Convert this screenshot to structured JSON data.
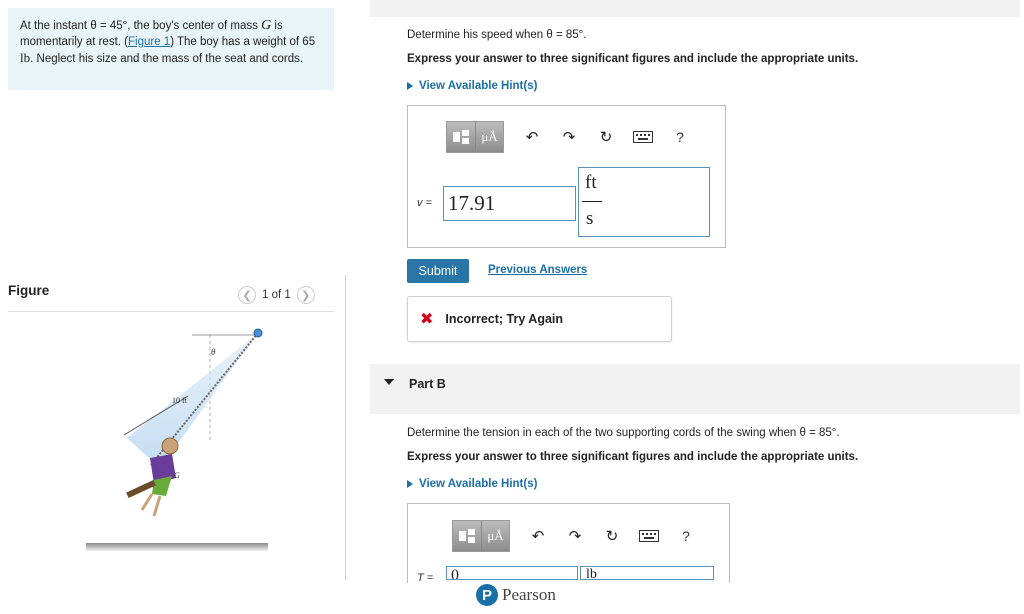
{
  "problem": {
    "text_1": "At the instant θ = 45°, the boy's center of mass ",
    "G": "G",
    "text_2": " is momentarily at rest. (",
    "figure_link": "Figure 1",
    "text_3": ") The boy has a weight of 65 ",
    "lb": "lb",
    "text_4": ". Neglect his size and the mass of the seat and cords."
  },
  "figure": {
    "heading": "Figure",
    "pager": "1 of 1",
    "prev_icon": "chevron-left-icon",
    "next_icon": "chevron-right-icon",
    "label_theta": "θ",
    "label_length": "10 ft",
    "label_G": "G"
  },
  "partA": {
    "question": "Determine his speed when θ = 85°.",
    "instruction": "Express your answer to three significant figures and include the appropriate units.",
    "hint_label": "View Available Hint(s)",
    "var_label": "v =",
    "value": "17.91",
    "unit_num": "ft",
    "unit_den": "s",
    "submit_label": "Submit",
    "previous_answers": "Previous Answers",
    "feedback": "Incorrect; Try Again"
  },
  "toolbar": {
    "mu_label": "μÅ",
    "undo_icon": "undo-icon",
    "redo_icon": "redo-icon",
    "reset_icon": "reset-icon",
    "keyboard_icon": "keyboard-icon",
    "help_label": "?"
  },
  "partB": {
    "title": "Part B",
    "question": "Determine the tension in each of the two supporting cords of the swing when θ = 85°.",
    "instruction": "Express your answer to three significant figures and include the appropriate units.",
    "hint_label": "View Available Hint(s)",
    "var_label": "T =",
    "value": "0",
    "unit": "lb"
  },
  "footer": {
    "brand": "Pearson",
    "logo_letter": "P"
  },
  "colors": {
    "link": "#1a6fa8",
    "submit": "#2a75a8",
    "problem_bg": "#e8f4f8",
    "error": "#d0021b"
  }
}
